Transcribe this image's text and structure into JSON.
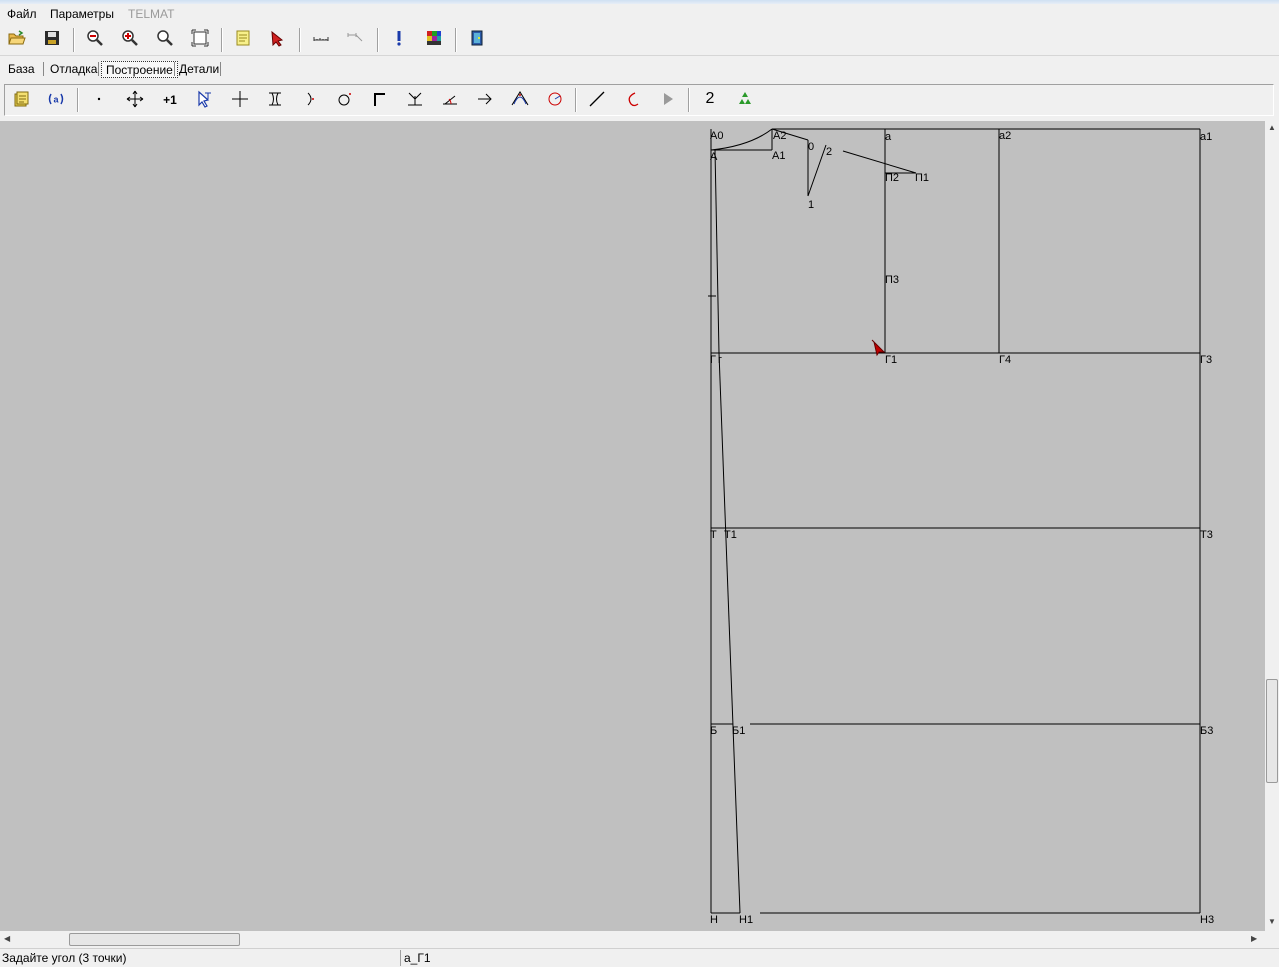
{
  "menu": {
    "file": "Файл",
    "params": "Параметры",
    "app": "TELMAT"
  },
  "toolbar1": {
    "icons": [
      "open-folder-icon",
      "save-icon",
      "zoom-out-icon",
      "zoom-in-icon",
      "zoom-icon",
      "zoom-fit-icon",
      "notes-icon",
      "pointer-icon",
      "measure-icon",
      "measure-angle-icon",
      "info-icon",
      "palette-icon",
      "exit-icon"
    ]
  },
  "tabs": {
    "base": "База",
    "debug": "Отладка",
    "build": "Построение",
    "details": "Детали"
  },
  "toolbar2": {
    "icons": [
      "list-icon",
      "variable-icon",
      "point-icon",
      "move-icon",
      "plus-one-icon",
      "select-icon",
      "cross-icon",
      "bracket-icon",
      "arc-point-icon",
      "circle-point-icon",
      "corner-icon",
      "perpendicular-icon",
      "angle-icon",
      "arrow-right-icon",
      "curve-points-icon",
      "circle-arc-icon",
      "line-icon",
      "curve-icon",
      "play-icon",
      "number-icon",
      "recycle-icon"
    ],
    "number_label": "2"
  },
  "drawing": {
    "labels": {
      "A0": "А0",
      "A": "А",
      "A1": "А1",
      "A2": "А2",
      "p0": "0",
      "p1": "1",
      "p2": "2",
      "a": "а",
      "a1": "а1",
      "a2": "а2",
      "P1": "П1",
      "P2": "П2",
      "P3": "П3",
      "G": "Г",
      "Gg": "г",
      "G1": "Г1",
      "G3": "Г3",
      "G4": "Г4",
      "T": "Т",
      "T1": "Т1",
      "T3": "Т3",
      "B": "Б",
      "B1": "Б1",
      "B3": "Б3",
      "H": "Н",
      "H1": "Н1",
      "H3": "Н3"
    }
  },
  "status": {
    "prompt": "Задайте угол (3 точки)",
    "current": "а_Г1"
  },
  "colors": {
    "canvas": "#c0c0c0",
    "line": "#000000",
    "cursor": "#c00000"
  }
}
